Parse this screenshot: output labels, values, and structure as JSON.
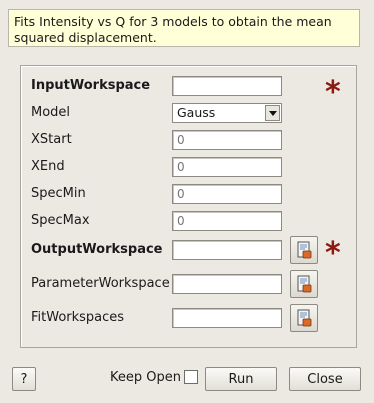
{
  "description": "Fits Intensity vs Q for 3 models to obtain the mean squared displacement.",
  "fields": {
    "input_workspace": {
      "label": "InputWorkspace",
      "value": ""
    },
    "model": {
      "label": "Model",
      "value": "Gauss"
    },
    "xstart": {
      "label": "XStart",
      "placeholder": "0"
    },
    "xend": {
      "label": "XEnd",
      "placeholder": "0"
    },
    "specmin": {
      "label": "SpecMin",
      "placeholder": "0"
    },
    "specmax": {
      "label": "SpecMax",
      "placeholder": "0"
    },
    "output_workspace": {
      "label": "OutputWorkspace",
      "value": ""
    },
    "parameter_workspace": {
      "label": "ParameterWorkspace",
      "value": ""
    },
    "fit_workspaces": {
      "label": "FitWorkspaces",
      "value": ""
    }
  },
  "mandatory_marker": "*",
  "footer": {
    "help_label": "?",
    "keep_open_label": "Keep Open",
    "keep_open_checked": false,
    "run_label": "Run",
    "close_label": "Close"
  },
  "icons": {
    "workspace_picker": "workspace-browse-icon",
    "combo_arrow": "chevron-down-icon",
    "mandatory": "asterisk-icon"
  },
  "colors": {
    "description_bg": "#ffffd8",
    "mandatory_star": "#8b1a10",
    "window_bg": "#ece9e2"
  }
}
